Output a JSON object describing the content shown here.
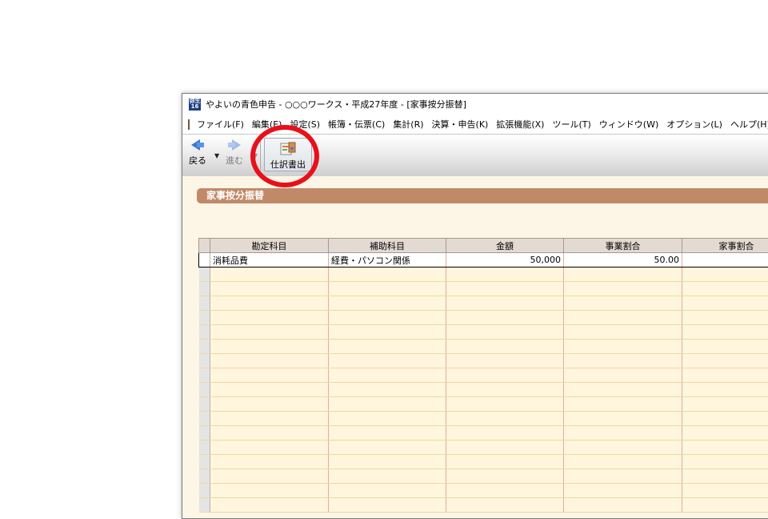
{
  "window": {
    "icon_label": "弥生16",
    "title": "やよいの青色申告 - ○○○ワークス・平成27年度 - [家事按分振替]"
  },
  "menubar": {
    "items": [
      "ファイル(F)",
      "編集(E)",
      "設定(S)",
      "帳簿・伝票(C)",
      "集計(R)",
      "決算・申告(K)",
      "拡張機能(X)",
      "ツール(T)",
      "ウィンドウ(W)",
      "オプション(L)",
      "ヘルプ(H)"
    ]
  },
  "toolbar": {
    "back_label": "戻る",
    "forward_label": "進む",
    "export_label": "仕訳書出",
    "back_icon": "arrow-left-icon",
    "forward_icon": "arrow-right-icon",
    "export_icon": "journal-export-icon"
  },
  "section": {
    "title": "家事按分振替"
  },
  "table": {
    "columns": [
      "勘定科目",
      "補助科目",
      "金額",
      "事業割合",
      "家事割合"
    ],
    "rows": [
      {
        "account": "消耗品費",
        "sub_account": "経費・パソコン関係",
        "amount": "50,000",
        "business_ratio": "50.00",
        "household_ratio": ""
      }
    ],
    "empty_rows": 17
  },
  "colors": {
    "section_header": "#c08a68",
    "grid_background": "#fff6dd",
    "annotation_circle": "#e8101a",
    "accent_blue": "#3a78d8"
  }
}
